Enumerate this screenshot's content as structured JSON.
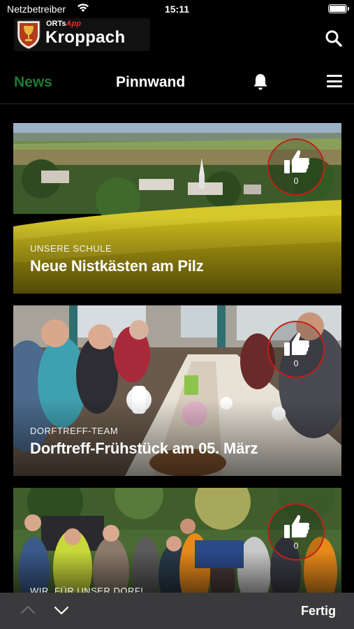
{
  "status_bar": {
    "carrier": "Netzbetreiber",
    "time": "15:11"
  },
  "header": {
    "logo_small": "ORTs",
    "logo_app": "App",
    "logo_big": "Kroppach"
  },
  "nav": {
    "news": "News",
    "pinnwand": "Pinnwand"
  },
  "cards": [
    {
      "category": "UNSERE SCHULE",
      "title": "Neue Nistkästen am Pilz",
      "likes": "0"
    },
    {
      "category": "DORFTREFF-TEAM",
      "title": "Dorftreff-Frühstück am 05. März",
      "likes": "0"
    },
    {
      "category": "WIR. FÜR UNSER DORF!",
      "title": "",
      "likes": "0"
    }
  ],
  "keyboard_toolbar": {
    "done": "Fertig"
  },
  "colors": {
    "accent_news": "#1d7a30",
    "like_ring": "#c0201a",
    "toolbar": "#3a3a3c"
  }
}
